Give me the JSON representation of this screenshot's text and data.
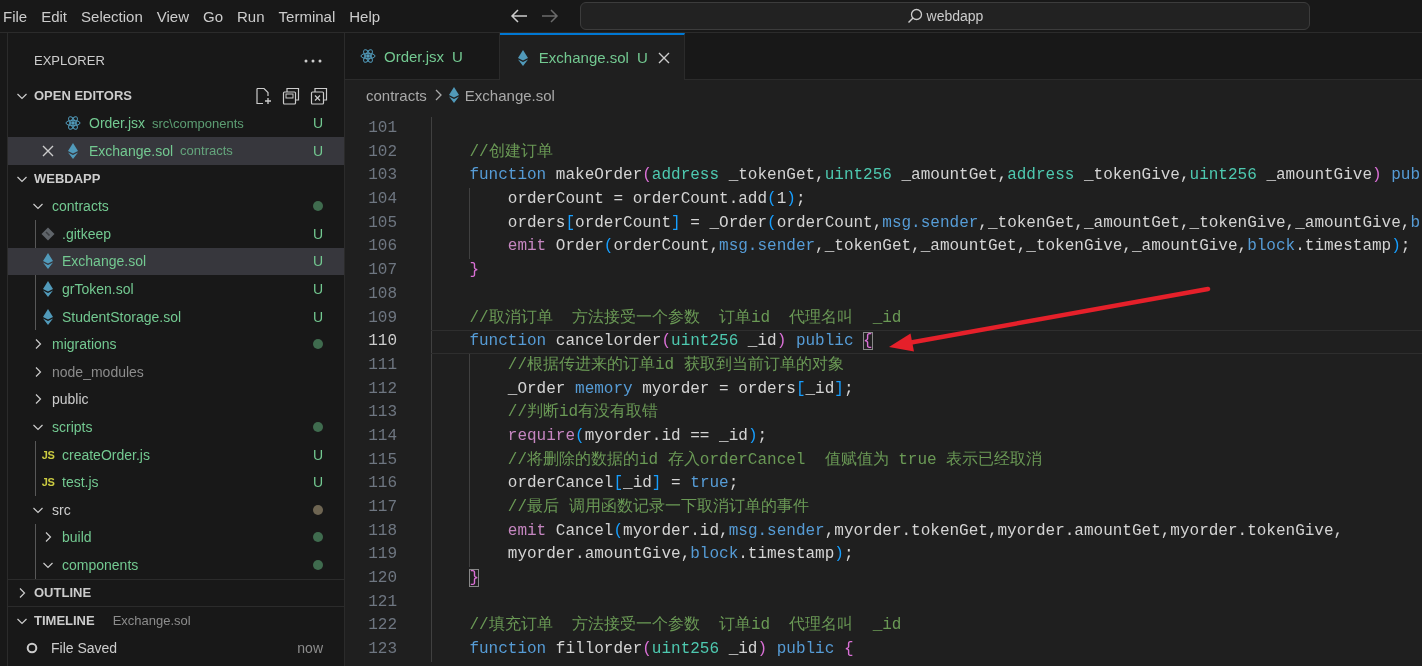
{
  "menu": [
    "File",
    "Edit",
    "Selection",
    "View",
    "Go",
    "Run",
    "Terminal",
    "Help"
  ],
  "nav_buttons": [
    {
      "kind": "back",
      "disabled": false
    },
    {
      "kind": "forward",
      "disabled": true
    }
  ],
  "command_center": {
    "text": "webdapp"
  },
  "sidebar": {
    "title": "EXPLORER",
    "sections": [
      {
        "kind": "open_editors",
        "title": "OPEN EDITORS",
        "expanded": true,
        "items": [
          {
            "kind": "react",
            "name": "Order.jsx",
            "description": "src\\components",
            "color": "#73c991",
            "badge": "U",
            "selected": false
          },
          {
            "kind": "sol",
            "name": "Exchange.sol",
            "description": "contracts",
            "color": "#73c991",
            "badge": "U",
            "selected": true
          }
        ]
      },
      {
        "kind": "folder",
        "title": "WEBDAPP",
        "expanded": true,
        "tree": [
          {
            "kind": "folder",
            "name": "contracts",
            "expanded": true,
            "color": "#73c991",
            "dot": {
              "color": "#3f6b4e"
            },
            "selected": false,
            "children": [
              {
                "kind": "git",
                "name": ".gitkeep",
                "color": "#73c991",
                "badge": "U",
                "selected": false
              },
              {
                "kind": "sol",
                "name": "Exchange.sol",
                "color": "#73c991",
                "badge": "U",
                "selected": true
              },
              {
                "kind": "sol",
                "name": "grToken.sol",
                "color": "#73c991",
                "badge": "U",
                "selected": false
              },
              {
                "kind": "sol",
                "name": "StudentStorage.sol",
                "color": "#73c991",
                "badge": "U",
                "selected": false
              }
            ]
          },
          {
            "kind": "folder",
            "name": "migrations",
            "expanded": false,
            "color": "#73c991",
            "dot": {
              "color": "#3f6b4e"
            },
            "selected": false
          },
          {
            "kind": "folder",
            "name": "node_modules",
            "expanded": false,
            "color": "#8c8c8c",
            "selected": false
          },
          {
            "kind": "folder",
            "name": "public",
            "expanded": false,
            "color": "#cccccc",
            "selected": false
          },
          {
            "kind": "folder",
            "name": "scripts",
            "expanded": true,
            "color": "#73c991",
            "dot": {
              "color": "#3f6b4e"
            },
            "selected": false,
            "children": [
              {
                "kind": "js",
                "icon_label": "JS",
                "name": "createOrder.js",
                "color": "#73c991",
                "badge": "U",
                "selected": false
              },
              {
                "kind": "js",
                "icon_label": "JS",
                "name": "test.js",
                "color": "#73c991",
                "badge": "U",
                "selected": false
              }
            ]
          },
          {
            "kind": "folder",
            "name": "src",
            "expanded": true,
            "color": "#cccccc",
            "dot": {
              "color": "#6e6552"
            },
            "selected": false,
            "children": [
              {
                "kind": "folder",
                "name": "build",
                "expanded": false,
                "color": "#73c991",
                "dot": {
                  "color": "#3f6b4e"
                },
                "selected": false
              },
              {
                "kind": "folder",
                "name": "components",
                "expanded": true,
                "color": "#73c991",
                "dot": {
                  "color": "#3f6b4e"
                },
                "selected": false
              }
            ]
          }
        ]
      },
      {
        "kind": "outline",
        "title": "OUTLINE",
        "expanded": false
      },
      {
        "kind": "timeline",
        "title": "TIMELINE",
        "subtitle": "Exchange.sol",
        "expanded": true,
        "entries": [
          {
            "label": "File Saved",
            "time": "now"
          }
        ]
      }
    ]
  },
  "tabs": [
    {
      "kind": "react",
      "label": "Order.jsx",
      "badge": "U",
      "selected": false
    },
    {
      "kind": "sol",
      "label": "Exchange.sol",
      "badge": "U",
      "selected": true
    }
  ],
  "breadcrumb": [
    {
      "kind": "folder",
      "label": "contracts"
    },
    {
      "kind": "sol",
      "label": "Exchange.sol"
    }
  ],
  "code": [
    {
      "number": "101",
      "current": false
    },
    {
      "number": "102",
      "current": false,
      "tokens": [
        {
          "kind": "comment",
          "text": "    //创建订单"
        }
      ]
    },
    {
      "number": "103",
      "current": false,
      "tokens": [
        {
          "kind": "kw",
          "text": "    function"
        },
        {
          "kind": "plain",
          "text": " makeOrder"
        },
        {
          "kind": "b1",
          "text": "("
        },
        {
          "kind": "type",
          "text": "address"
        },
        {
          "kind": "plain",
          "text": " _tokenGet,"
        },
        {
          "kind": "type",
          "text": "uint256"
        },
        {
          "kind": "plain",
          "text": " _amountGet,"
        },
        {
          "kind": "type",
          "text": "address"
        },
        {
          "kind": "plain",
          "text": " _tokenGive,"
        },
        {
          "kind": "type",
          "text": "uint256"
        },
        {
          "kind": "plain",
          "text": " _amountGive"
        },
        {
          "kind": "b1",
          "text": ")"
        },
        {
          "kind": "kw",
          "text": " pub"
        }
      ]
    },
    {
      "number": "104",
      "current": false,
      "tokens": [
        {
          "kind": "plain",
          "text": "        orderCount = orderCount.add"
        },
        {
          "kind": "b2",
          "text": "("
        },
        {
          "kind": "plain",
          "text": "1"
        },
        {
          "kind": "b2",
          "text": ")"
        },
        {
          "kind": "plain",
          "text": ";"
        }
      ]
    },
    {
      "number": "105",
      "current": false,
      "tokens": [
        {
          "kind": "plain",
          "text": "        orders"
        },
        {
          "kind": "b2",
          "text": "["
        },
        {
          "kind": "plain",
          "text": "orderCount"
        },
        {
          "kind": "b2",
          "text": "]"
        },
        {
          "kind": "plain",
          "text": " = _Order"
        },
        {
          "kind": "b2",
          "text": "("
        },
        {
          "kind": "plain",
          "text": "orderCount,"
        },
        {
          "kind": "kw",
          "text": "msg.sender"
        },
        {
          "kind": "plain",
          "text": ",_tokenGet,_amountGet,_tokenGive,_amountGive,"
        },
        {
          "kind": "kw",
          "text": "b"
        }
      ]
    },
    {
      "number": "106",
      "current": false,
      "tokens": [
        {
          "kind": "ctrl",
          "text": "        emit"
        },
        {
          "kind": "plain",
          "text": " Order"
        },
        {
          "kind": "b2",
          "text": "("
        },
        {
          "kind": "plain",
          "text": "orderCount,"
        },
        {
          "kind": "kw",
          "text": "msg.sender"
        },
        {
          "kind": "plain",
          "text": ",_tokenGet,_amountGet,_tokenGive,_amountGive,"
        },
        {
          "kind": "kw",
          "text": "block"
        },
        {
          "kind": "plain",
          "text": ".timestamp"
        },
        {
          "kind": "b2",
          "text": ")"
        },
        {
          "kind": "plain",
          "text": ";"
        }
      ]
    },
    {
      "number": "107",
      "current": false,
      "tokens": [
        {
          "kind": "b1",
          "text": "    }"
        }
      ]
    },
    {
      "number": "108",
      "current": false
    },
    {
      "number": "109",
      "current": false,
      "tokens": [
        {
          "kind": "comment",
          "text": "    //取消订单  方法接受一个参数  订单id  代理名叫  _id"
        }
      ]
    },
    {
      "number": "110",
      "current": true,
      "tokens": [
        {
          "kind": "kw",
          "text": "    function"
        },
        {
          "kind": "plain",
          "text": " cancelorder"
        },
        {
          "kind": "b1",
          "text": "("
        },
        {
          "kind": "type",
          "text": "uint256"
        },
        {
          "kind": "plain",
          "text": " _id"
        },
        {
          "kind": "b1",
          "text": ")"
        },
        {
          "kind": "kw",
          "text": " public"
        },
        {
          "kind": "match",
          "text": " {"
        }
      ]
    },
    {
      "number": "111",
      "current": false,
      "tokens": [
        {
          "kind": "comment",
          "text": "        //根据传进来的订单id 获取到当前订单的对象"
        }
      ]
    },
    {
      "number": "112",
      "current": false,
      "tokens": [
        {
          "kind": "plain",
          "text": "        _Order "
        },
        {
          "kind": "kw",
          "text": "memory"
        },
        {
          "kind": "plain",
          "text": " myorder = orders"
        },
        {
          "kind": "b2",
          "text": "["
        },
        {
          "kind": "plain",
          "text": "_id"
        },
        {
          "kind": "b2",
          "text": "]"
        },
        {
          "kind": "plain",
          "text": ";"
        }
      ]
    },
    {
      "number": "113",
      "current": false,
      "tokens": [
        {
          "kind": "comment",
          "text": "        //判断id有没有取错"
        }
      ]
    },
    {
      "number": "114",
      "current": false,
      "tokens": [
        {
          "kind": "ctrl",
          "text": "        require"
        },
        {
          "kind": "b2",
          "text": "("
        },
        {
          "kind": "plain",
          "text": "myorder.id == _id"
        },
        {
          "kind": "b2",
          "text": ")"
        },
        {
          "kind": "plain",
          "text": ";"
        }
      ]
    },
    {
      "number": "115",
      "current": false,
      "tokens": [
        {
          "kind": "comment",
          "text": "        //将删除的数据的id 存入orderCancel  值赋值为 true 表示已经取消"
        }
      ]
    },
    {
      "number": "116",
      "current": false,
      "tokens": [
        {
          "kind": "plain",
          "text": "        orderCancel"
        },
        {
          "kind": "b2",
          "text": "["
        },
        {
          "kind": "plain",
          "text": "_id"
        },
        {
          "kind": "b2",
          "text": "]"
        },
        {
          "kind": "plain",
          "text": " = "
        },
        {
          "kind": "kw",
          "text": "true"
        },
        {
          "kind": "plain",
          "text": ";"
        }
      ]
    },
    {
      "number": "117",
      "current": false,
      "tokens": [
        {
          "kind": "comment",
          "text": "        //最后 调用函数记录一下取消订单的事件"
        }
      ]
    },
    {
      "number": "118",
      "current": false,
      "tokens": [
        {
          "kind": "ctrl",
          "text": "        emit"
        },
        {
          "kind": "plain",
          "text": " Cancel"
        },
        {
          "kind": "b2",
          "text": "("
        },
        {
          "kind": "plain",
          "text": "myorder.id,"
        },
        {
          "kind": "kw",
          "text": "msg.sender"
        },
        {
          "kind": "plain",
          "text": ",myorder.tokenGet,myorder.amountGet,myorder.tokenGive,"
        }
      ]
    },
    {
      "number": "119",
      "current": false,
      "tokens": [
        {
          "kind": "plain",
          "text": "        myorder.amountGive,"
        },
        {
          "kind": "kw",
          "text": "block"
        },
        {
          "kind": "plain",
          "text": ".timestamp"
        },
        {
          "kind": "b2",
          "text": ")"
        },
        {
          "kind": "plain",
          "text": ";"
        }
      ]
    },
    {
      "number": "120",
      "current": false,
      "tokens": [
        {
          "kind": "match",
          "text": "    }"
        }
      ]
    },
    {
      "number": "121",
      "current": false
    },
    {
      "number": "122",
      "current": false,
      "tokens": [
        {
          "kind": "comment",
          "text": "    //填充订单  方法接受一个参数  订单id  代理名叫  _id"
        }
      ]
    },
    {
      "number": "123",
      "current": false,
      "tokens": [
        {
          "kind": "kw",
          "text": "    function"
        },
        {
          "kind": "plain",
          "text": " fillorder"
        },
        {
          "kind": "b1",
          "text": "("
        },
        {
          "kind": "type",
          "text": "uint256"
        },
        {
          "kind": "plain",
          "text": " _id"
        },
        {
          "kind": "b1",
          "text": ")"
        },
        {
          "kind": "kw",
          "text": " public"
        },
        {
          "kind": "b1",
          "text": " {"
        }
      ]
    }
  ],
  "annotations": [
    {
      "kind": "arrow"
    }
  ]
}
